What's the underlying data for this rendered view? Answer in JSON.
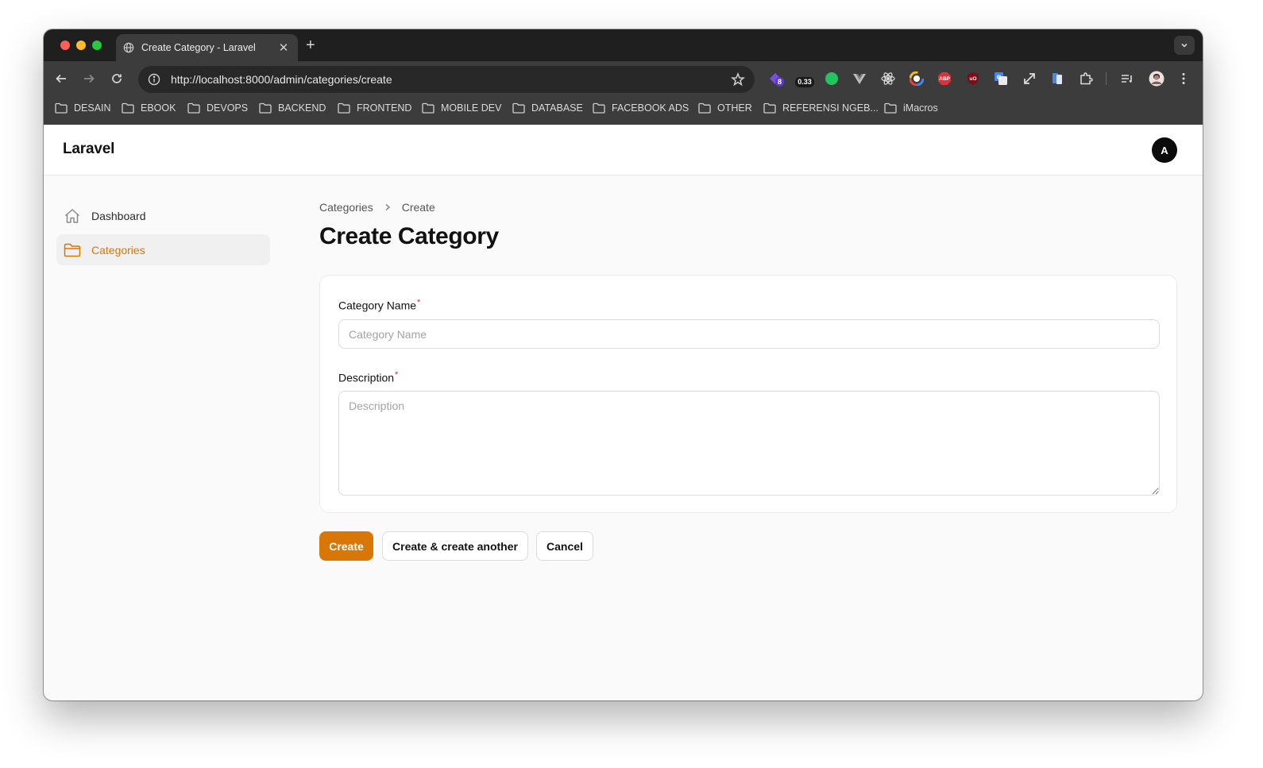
{
  "browser": {
    "tab_title": "Create Category - Laravel",
    "url": "http://localhost:8000/admin/categories/create",
    "extensions": {
      "badge_count": "8",
      "speed_value": "0.33",
      "abp_label": "ABP",
      "ublock_label": "uO"
    },
    "bookmarks": [
      "DESAIN",
      "EBOOK",
      "DEVOPS",
      "BACKEND",
      "FRONTEND",
      "MOBILE DEV",
      "DATABASE",
      "FACEBOOK ADS",
      "OTHER",
      "REFERENSI NGEB...",
      "iMacros"
    ]
  },
  "app": {
    "brand": "Laravel",
    "avatar_initial": "A"
  },
  "sidebar": {
    "items": [
      {
        "label": "Dashboard",
        "icon": "home-icon",
        "active": false
      },
      {
        "label": "Categories",
        "icon": "folder-icon",
        "active": true
      }
    ]
  },
  "breadcrumb": {
    "items": [
      "Categories",
      "Create"
    ]
  },
  "page": {
    "title": "Create Category"
  },
  "form": {
    "name_label": "Category Name",
    "name_required": "*",
    "name_placeholder": "Category Name",
    "name_value": "",
    "description_label": "Description",
    "description_required": "*",
    "description_placeholder": "Description",
    "description_value": ""
  },
  "actions": {
    "create": "Create",
    "create_another": "Create & create another",
    "cancel": "Cancel"
  },
  "colors": {
    "accent": "#d97706",
    "required": "#dc2626"
  }
}
